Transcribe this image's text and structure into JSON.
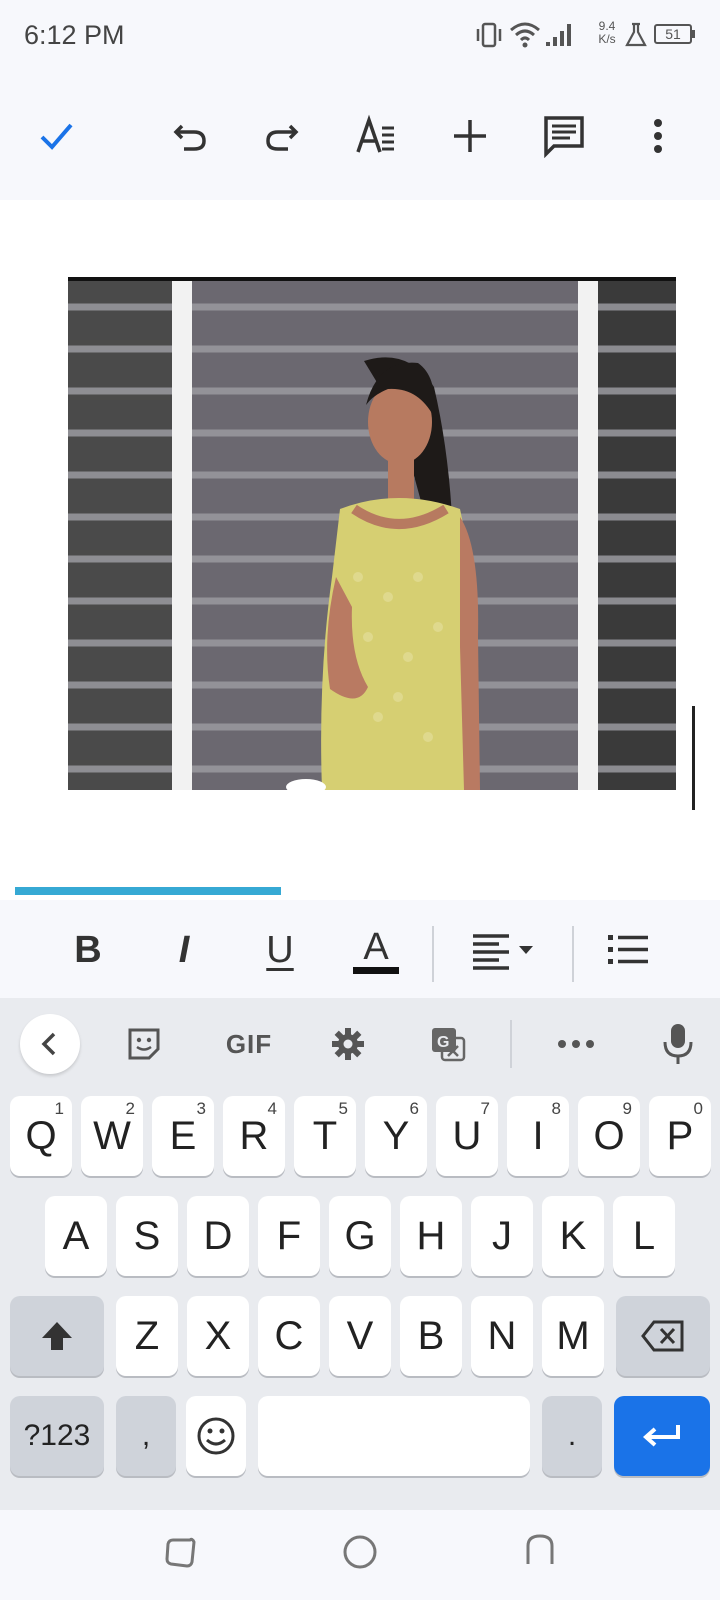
{
  "status_bar": {
    "time": "6:12 PM",
    "net_speed_value": "9.4",
    "net_speed_unit": "K/s",
    "battery": "51"
  },
  "toolbar": {
    "icons": [
      "check-icon",
      "undo-icon",
      "redo-icon",
      "text-format-icon",
      "add-icon",
      "comment-icon",
      "more-vert-icon"
    ],
    "accent_color": "#1a73e8"
  },
  "document": {
    "image_alt": "Photo of a woman in a yellow sleeveless dress standing in front of a metal shutter",
    "progress_fraction": 0.37
  },
  "format_bar": {
    "bold": "B",
    "italic": "I",
    "underline": "U",
    "text_color": "A"
  },
  "keyboard": {
    "suggestions": {
      "gif": "GIF"
    },
    "row1": [
      {
        "key": "Q",
        "hint": "1"
      },
      {
        "key": "W",
        "hint": "2"
      },
      {
        "key": "E",
        "hint": "3"
      },
      {
        "key": "R",
        "hint": "4"
      },
      {
        "key": "T",
        "hint": "5"
      },
      {
        "key": "Y",
        "hint": "6"
      },
      {
        "key": "U",
        "hint": "7"
      },
      {
        "key": "I",
        "hint": "8"
      },
      {
        "key": "O",
        "hint": "9"
      },
      {
        "key": "P",
        "hint": "0"
      }
    ],
    "row2": [
      "A",
      "S",
      "D",
      "F",
      "G",
      "H",
      "J",
      "K",
      "L"
    ],
    "row3": [
      "Z",
      "X",
      "C",
      "V",
      "B",
      "N",
      "M"
    ],
    "symbols_key": "?123",
    "comma_key": ",",
    "period_key": ".",
    "enter_color": "#1a73e8"
  }
}
